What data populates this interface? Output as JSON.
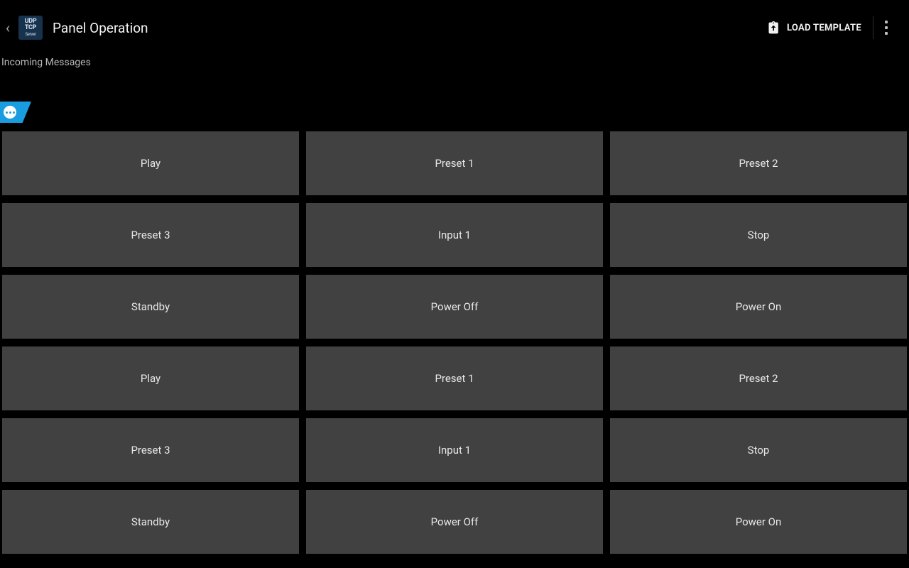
{
  "header": {
    "app_logo_lines": [
      "UDP",
      "TCP",
      "Server"
    ],
    "page_title": "Panel Operation",
    "load_template_label": "LOAD TEMPLATE"
  },
  "incoming_label": "Incoming Messages",
  "panel_buttons": [
    "Play",
    "Preset 1",
    "Preset 2",
    "Preset 3",
    "Input 1",
    "Stop",
    "Standby",
    "Power Off",
    "Power On",
    "Play",
    "Preset 1",
    "Preset 2",
    "Preset 3",
    "Input 1",
    "Stop",
    "Standby",
    "Power Off",
    "Power On"
  ]
}
